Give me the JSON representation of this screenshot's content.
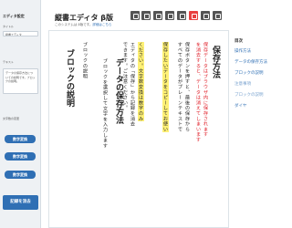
{
  "app": {
    "title": "縦書エディタ β版",
    "subtitle_prefix": "このシステムは β版です。",
    "subtitle_link": "詳細はこちら"
  },
  "sidebar": {
    "title": "エディタ設定",
    "title_field_label": "タイトル",
    "title_field_value": "縦書エディタ",
    "text_label": "テキスト",
    "textarea_value": "データの保存方法についての説明です。ブロックの説明。",
    "ops_label": "文字数の変更",
    "buttons": [
      "数字変換",
      "数字変換",
      "数字変換"
    ],
    "reset_label": "記録を消去"
  },
  "toolbar": {
    "buttons": [
      "bold-icon",
      "italic-icon",
      "underline-icon",
      "strike-icon",
      "h1-icon",
      "h2-icon",
      "color-icon",
      "ruby-icon"
    ],
    "active_color": "#e84040",
    "base_color": "#555555"
  },
  "editor": {
    "heading_1": "保存方法",
    "red_line_1": "保存データはブラウザ内に保存されます",
    "red_line_2": "を消去すると、データは消えてしまいます",
    "line_3": "保存ボタンを押すと、最後の保存から",
    "line_4": "すべてのデータがプレーンテキストで",
    "hl_line_1": "保存したいデータをコピーしてお使い",
    "hl_line_2": "ください。文字数変換は数字のみ",
    "line_5": "エディタの「保存」から記録を消去",
    "line_6": "できます。ご注意ください。",
    "heading_2": "データの保存方法",
    "line_7": "ブロックを選択して文字を入力します",
    "line_8": "ブロックの説明",
    "heading_3": "ブロックの説明"
  },
  "toc": {
    "title": "目次",
    "items": [
      "操作方法",
      "データの保存方法",
      "ブロックの説明",
      "注意事項",
      "ブロックの説明",
      "ダイヤ"
    ]
  }
}
